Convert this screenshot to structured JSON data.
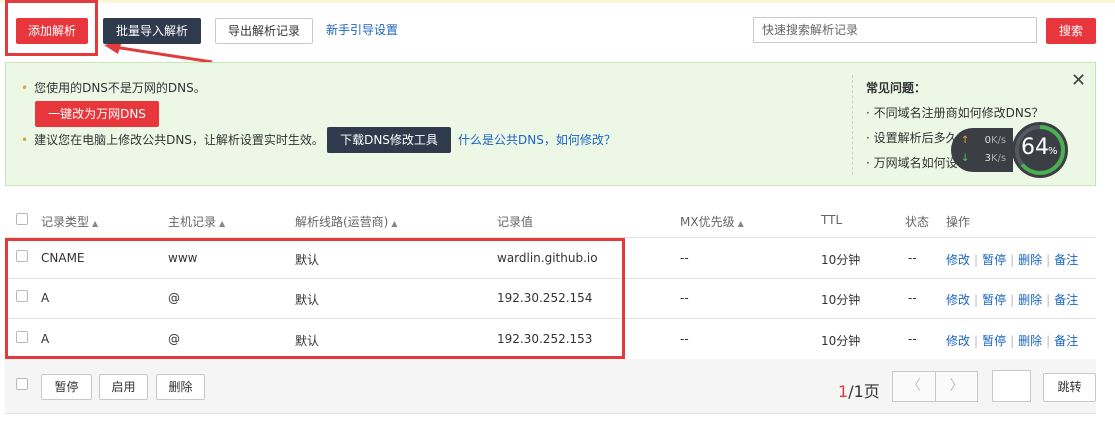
{
  "toolbar": {
    "add_label": "添加解析",
    "batch_import_label": "批量导入解析",
    "export_label": "导出解析记录",
    "guide_link": "新手引导设置",
    "search_placeholder": "快速搜索解析记录",
    "search_label": "搜索"
  },
  "notice": {
    "line1": "您使用的DNS不是万网的DNS。",
    "switch_button": "一键改为万网DNS",
    "line2": "建议您在电脑上修改公共DNS，让解析设置实时生效。",
    "tool_button": "下载DNS修改工具",
    "public_dns_link": "什么是公共DNS，如何修改？",
    "faq_title": "常见问题：",
    "faq_items": [
      "· 不同域名注册商如何修改DNS？",
      "· 设置解析后多久",
      "· 万网域名如何设"
    ]
  },
  "speed_widget": {
    "up": "0",
    "down": "3",
    "unit": "K/s",
    "percent": "64",
    "percent_sign": "%",
    "ring_color": "#4caf50"
  },
  "table": {
    "headers": {
      "type": "记录类型",
      "host": "主机记录",
      "line": "解析线路(运营商)",
      "value": "记录值",
      "mx": "MX优先级",
      "ttl": "TTL",
      "status": "状态",
      "ops": "操作"
    },
    "rows": [
      {
        "type": "CNAME",
        "host": "www",
        "line": "默认",
        "value": "wardlin.github.io",
        "mx": "--",
        "ttl": "10分钟",
        "status": "--"
      },
      {
        "type": "A",
        "host": "@",
        "line": "默认",
        "value": "192.30.252.154",
        "mx": "--",
        "ttl": "10分钟",
        "status": "--"
      },
      {
        "type": "A",
        "host": "@",
        "line": "默认",
        "value": "192.30.252.153",
        "mx": "--",
        "ttl": "10分钟",
        "status": "--"
      }
    ],
    "ops": {
      "edit": "修改",
      "pause": "暂停",
      "delete": "删除",
      "note": "备注"
    }
  },
  "footer": {
    "pause_label": "暂停",
    "enable_label": "启用",
    "delete_label": "删除",
    "page_current": "1",
    "page_rest": "/1页",
    "prev_glyph": "〈",
    "next_glyph": "〉",
    "jump_label": "跳转"
  }
}
